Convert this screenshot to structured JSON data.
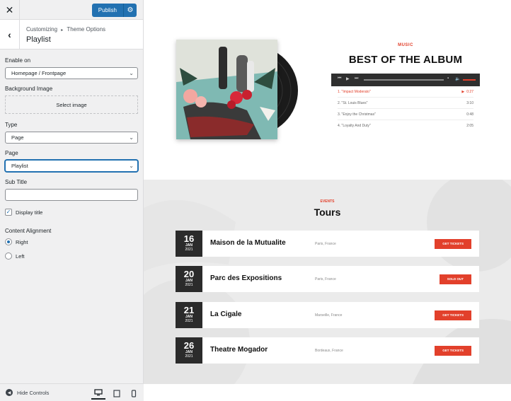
{
  "topbar": {
    "close_icon": "close-icon",
    "publish_label": "Publish",
    "gear_icon": "gear-icon"
  },
  "section": {
    "breadcrumb_root": "Customizing",
    "breadcrumb_sep": "▸",
    "breadcrumb_parent": "Theme Options",
    "title": "Playlist"
  },
  "controls": {
    "enable_on": {
      "label": "Enable on",
      "value": "Homepage / Frontpage"
    },
    "background_image": {
      "label": "Background Image",
      "button": "Select image"
    },
    "type": {
      "label": "Type",
      "value": "Page"
    },
    "page": {
      "label": "Page",
      "value": "Playlist"
    },
    "sub_title": {
      "label": "Sub Title",
      "value": ""
    },
    "display_title": {
      "label": "Display title",
      "checked": true
    },
    "content_alignment": {
      "label": "Content Alignment",
      "options": [
        "Right",
        "Left"
      ],
      "selected": "Right"
    }
  },
  "footer": {
    "hide_controls": "Hide Controls",
    "devices": [
      "desktop",
      "tablet",
      "mobile"
    ],
    "active_device": "desktop"
  },
  "album": {
    "tag": "MUSIC",
    "title": "BEST OF THE ALBUM",
    "tracks": [
      {
        "title": "1. \"Impact Moderato\"",
        "duration": "0:27",
        "current": true
      },
      {
        "title": "2. \"St. Louis Blues\"",
        "duration": "3:10",
        "current": false
      },
      {
        "title": "3. \"Enjoy the Christmas\"",
        "duration": "0:48",
        "current": false
      },
      {
        "title": "4. \"Loyalty And Duty\"",
        "duration": "2:05",
        "current": false
      }
    ]
  },
  "tours": {
    "tag": "EVENTS",
    "title": "Tours",
    "items": [
      {
        "day": "16",
        "month": "JAN",
        "year": "2021",
        "venue": "Maison de la Mutualite",
        "location": "Paris, France",
        "button": "GET TICKETS"
      },
      {
        "day": "20",
        "month": "JAN",
        "year": "2021",
        "venue": "Parc des Expositions",
        "location": "Paris, France",
        "button": "SOLD OUT"
      },
      {
        "day": "21",
        "month": "JAN",
        "year": "2021",
        "venue": "La Cigale",
        "location": "Marseille, France",
        "button": "GET TICKETS"
      },
      {
        "day": "26",
        "month": "JAN",
        "year": "2021",
        "venue": "Theatre Mogador",
        "location": "Bordeaux, France",
        "button": "GET TICKETS"
      }
    ]
  },
  "colors": {
    "accent": "#e2402b",
    "wp_blue": "#2271b1",
    "dark": "#2b2b2b"
  }
}
